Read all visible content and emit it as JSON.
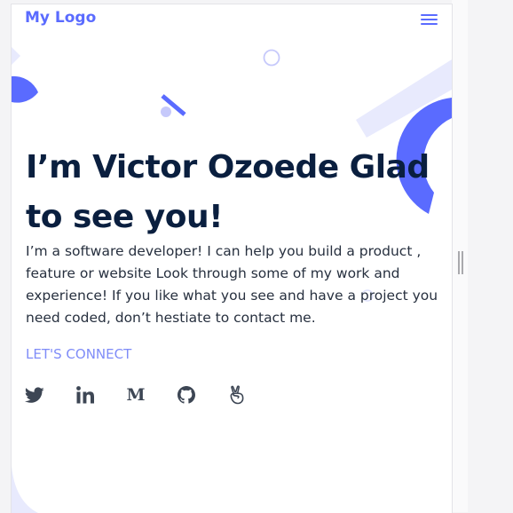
{
  "navbar": {
    "logo": "My Logo",
    "menu_icon": "hamburger-menu-icon"
  },
  "hero": {
    "title_line1": "I’m Victor Ozoede Glad",
    "title_line2": "to see you!",
    "description": "I’m a software developer! I can help you build a product , feature or website Look through some of my work and experience! If you like what you see and have a project you need coded, don’t hestiate to contact me.",
    "cta_label": "LET'S CONNECT"
  },
  "socials": [
    {
      "icon": "twitter-icon"
    },
    {
      "icon": "linkedin-icon"
    },
    {
      "icon": "medium-icon",
      "glyph": "M"
    },
    {
      "icon": "github-icon"
    },
    {
      "icon": "angellist-icon"
    }
  ],
  "colors": {
    "brand": "#5a6bff",
    "title": "#0a1f3f",
    "text": "#27303f",
    "cta": "#7f8cf8",
    "icon": "#3d4654",
    "decoration_light": "#e8eafd"
  }
}
